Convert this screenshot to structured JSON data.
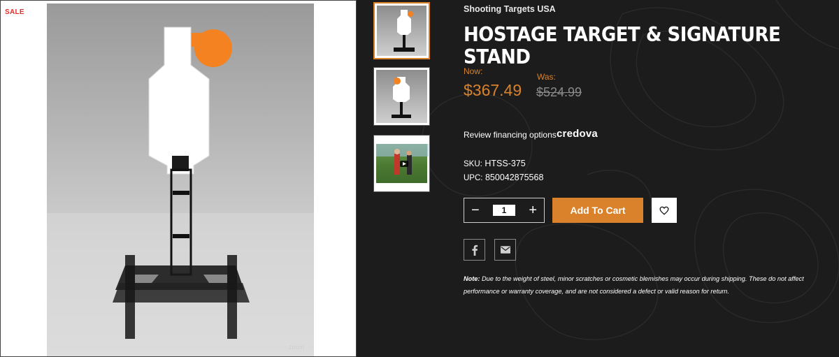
{
  "badge": {
    "sale": "SALE"
  },
  "product": {
    "brand": "Shooting Targets USA",
    "title": "Hostage Target & Signature Stand",
    "now_label": "Now:",
    "now_price": "$367.49",
    "was_label": "Was:",
    "was_price": "$524.99",
    "financing_text": "Review financing options",
    "financing_brand": "credova",
    "sku_label": "SKU:",
    "sku": "HTSS-375",
    "upc_label": "UPC:",
    "upc": "850042875568"
  },
  "cart": {
    "quantity": "1",
    "minus": "−",
    "plus": "+",
    "add_label": "Add To Cart"
  },
  "note": {
    "lead": "Note:",
    "text": " Due to the weight of steel, minor scratches or cosmetic blemishes may occur during shipping. These do not affect performance or warranty coverage, and are not considered a defect or valid reason for return."
  },
  "icons": {
    "wishlist": "heart-icon",
    "facebook": "facebook-icon",
    "email": "envelope-icon",
    "play": "play-icon"
  },
  "colors": {
    "accent": "#d9822b",
    "background": "#1c1c1c",
    "sale": "#e0302c",
    "was_price": "#8b8b8b"
  }
}
